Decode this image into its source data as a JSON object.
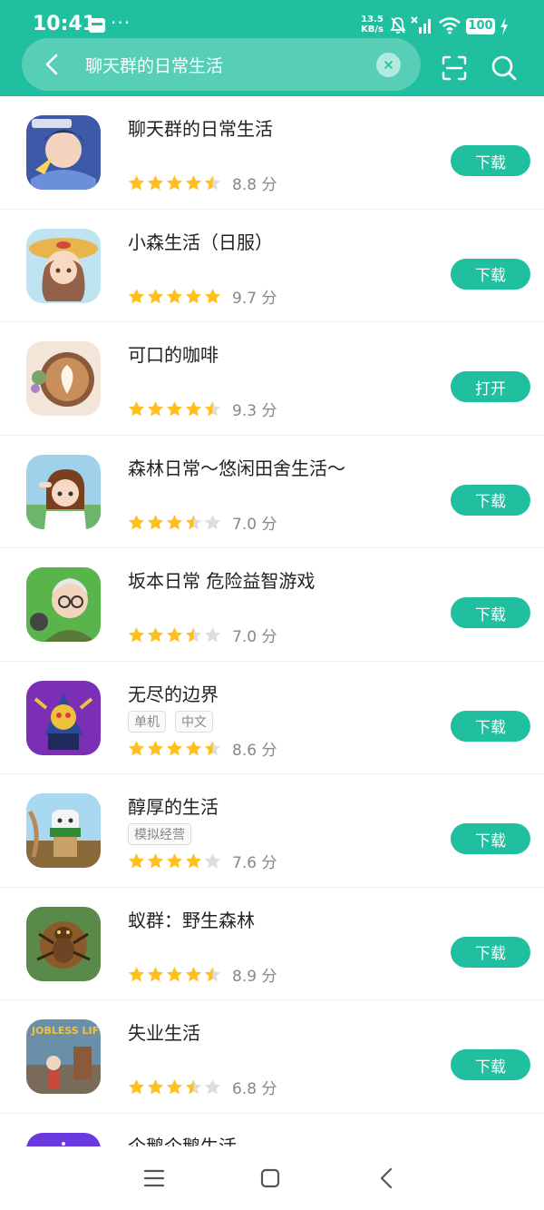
{
  "status_bar": {
    "time": "10:41",
    "dots": "···",
    "speed_value": "13.5",
    "speed_unit": "KB/s",
    "battery": "100"
  },
  "search": {
    "query": "聊天群的日常生活",
    "clear_symbol": "×"
  },
  "colors": {
    "accent": "#1fbf9f",
    "star": "#ffbf1f",
    "star_empty": "#dddddd"
  },
  "apps": [
    {
      "name": "聊天群的日常生活",
      "score": "8.8 分",
      "rating": 4.5,
      "tags": [],
      "action": "下载",
      "icon": "anime-boy-game-icon"
    },
    {
      "name": "小森生活（日服）",
      "score": "9.7 分",
      "rating": 5,
      "tags": [],
      "action": "下载",
      "icon": "straw-hat-girl-game-icon"
    },
    {
      "name": "可口的咖啡",
      "score": "9.3 分",
      "rating": 4.5,
      "tags": [],
      "action": "打开",
      "icon": "latte-art-game-icon"
    },
    {
      "name": "森林日常～悠闲田舍生活～",
      "score": "7.0 分",
      "rating": 3.5,
      "tags": [],
      "action": "下载",
      "icon": "salute-girl-game-icon"
    },
    {
      "name": "坂本日常 危险益智游戏",
      "score": "7.0 分",
      "rating": 3.5,
      "tags": [],
      "action": "下载",
      "icon": "old-man-game-icon"
    },
    {
      "name": "无尽的边界",
      "score": "8.6 分",
      "rating": 4.5,
      "tags": [
        "单机",
        "中文"
      ],
      "action": "下载",
      "icon": "robot-warrior-game-icon"
    },
    {
      "name": "醇厚的生活",
      "score": "7.6 分",
      "rating": 4,
      "tags": [
        "模拟经营"
      ],
      "action": "下载",
      "icon": "masked-character-game-icon"
    },
    {
      "name": "蚁群：野生森林",
      "score": "8.9 分",
      "rating": 4.5,
      "tags": [],
      "action": "下载",
      "icon": "ant-game-icon"
    },
    {
      "name": "失业生活",
      "score": "6.8 分",
      "rating": 3.5,
      "tags": [],
      "action": "下载",
      "icon": "jobless-life-game-icon",
      "icon_text": "JOBLESS LIFE"
    },
    {
      "name": "企鹅企鹅生活",
      "score": "",
      "rating": 0,
      "tags": [],
      "action": "",
      "icon": "penguin-game-icon"
    }
  ]
}
